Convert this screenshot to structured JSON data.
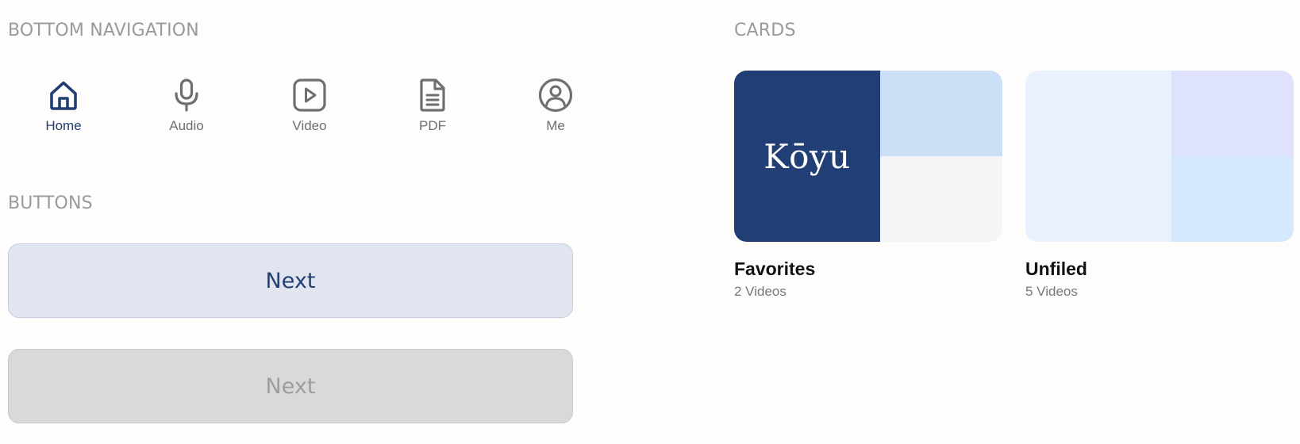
{
  "sections": {
    "bottom_navigation": "BOTTOM NAVIGATION",
    "buttons": "BUTTONS",
    "cards": "CARDS"
  },
  "bottom_nav": {
    "active_color": "#223f75",
    "inactive_color": "#6f6f6f",
    "items": [
      {
        "label": "Home",
        "icon": "home-icon",
        "active": true
      },
      {
        "label": "Audio",
        "icon": "microphone-icon",
        "active": false
      },
      {
        "label": "Video",
        "icon": "play-icon",
        "active": false
      },
      {
        "label": "PDF",
        "icon": "document-icon",
        "active": false
      },
      {
        "label": "Me",
        "icon": "user-icon",
        "active": false
      }
    ]
  },
  "buttons": {
    "primary_label": "Next",
    "disabled_label": "Next"
  },
  "cards": [
    {
      "title": "Favorites",
      "subtitle": "2 Videos",
      "logo_text": "Kōyu",
      "colors": [
        "#223f75",
        "#cbe0f6",
        "#f4f5f7"
      ]
    },
    {
      "title": "Unfiled",
      "subtitle": "5 Videos",
      "colors": [
        "#eaf1fe",
        "#dfe2fd",
        "#d6e8fd"
      ]
    }
  ]
}
